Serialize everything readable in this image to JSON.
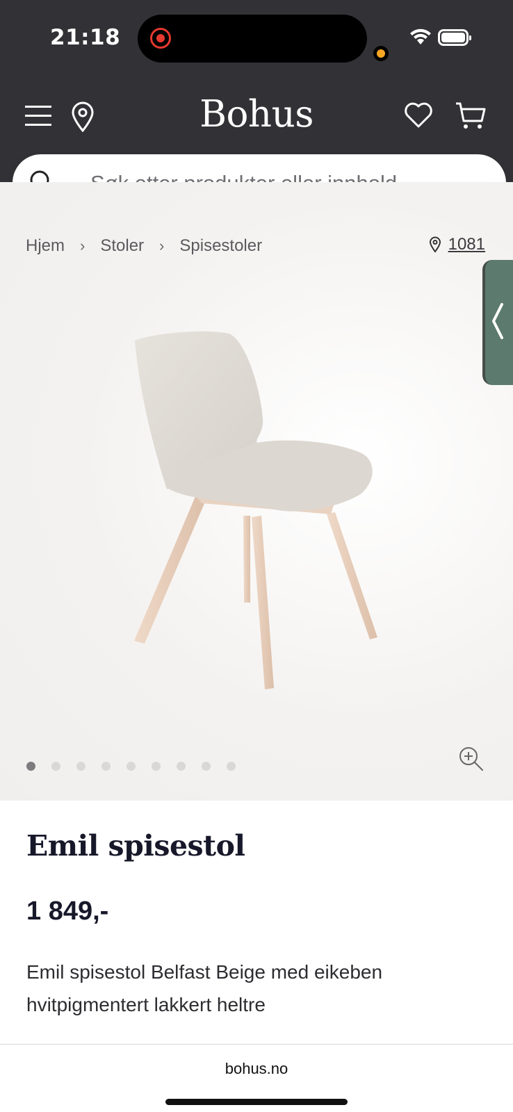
{
  "status_bar": {
    "time": "21:18"
  },
  "header": {
    "logo": "Bohus",
    "icons": [
      "menu-icon",
      "location-pin-icon",
      "heart-icon",
      "cart-icon"
    ],
    "background_color": "#323236"
  },
  "search": {
    "placeholder": "Søk etter produkter eller innhold..."
  },
  "breadcrumb": {
    "items": [
      "Hjem",
      "Stoler",
      "Spisestoler"
    ]
  },
  "store": {
    "code": "1081"
  },
  "gallery": {
    "image_count": 9,
    "active_index": 0
  },
  "product": {
    "title": "Emil spisestol",
    "price": "1 849,-",
    "description": "Emil spisestol Belfast Beige med eikeben hvitpigmentert lakkert heltre"
  },
  "browser": {
    "url": "bohus.no"
  }
}
